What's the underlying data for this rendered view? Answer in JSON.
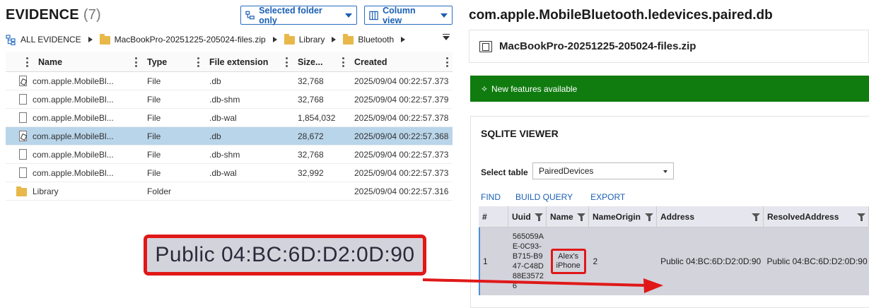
{
  "evidence": {
    "title": "EVIDENCE",
    "count": "(7)",
    "buttons": {
      "folder_filter": "Selected folder only",
      "column_view": "Column view"
    },
    "breadcrumb": [
      "ALL EVIDENCE",
      "MacBookPro-20251225-205024-files.zip",
      "Library",
      "Bluetooth"
    ],
    "columns": [
      "Name",
      "Type",
      "File extension",
      "Size...",
      "Created"
    ],
    "rows": [
      {
        "name": "com.apple.MobileBl...",
        "type": "File",
        "ext": ".db",
        "size": "32,768",
        "created": "2025/09/04 00:22:57.373",
        "icon": "sqlite-file-icon"
      },
      {
        "name": "com.apple.MobileBl...",
        "type": "File",
        "ext": ".db-shm",
        "size": "32,768",
        "created": "2025/09/04 00:22:57.379",
        "icon": "file-icon"
      },
      {
        "name": "com.apple.MobileBl...",
        "type": "File",
        "ext": ".db-wal",
        "size": "1,854,032",
        "created": "2025/09/04 00:22:57.378",
        "icon": "file-icon"
      },
      {
        "name": "com.apple.MobileBl...",
        "type": "File",
        "ext": ".db",
        "size": "28,672",
        "created": "2025/09/04 00:22:57.368",
        "icon": "sqlite-file-icon",
        "selected": true
      },
      {
        "name": "com.apple.MobileBl...",
        "type": "File",
        "ext": ".db-shm",
        "size": "32,768",
        "created": "2025/09/04 00:22:57.373",
        "icon": "file-icon"
      },
      {
        "name": "com.apple.MobileBl...",
        "type": "File",
        "ext": ".db-wal",
        "size": "32,992",
        "created": "2025/09/04 00:22:57.373",
        "icon": "file-icon"
      },
      {
        "name": "Library",
        "type": "Folder",
        "ext": "",
        "size": "",
        "created": "2025/09/04 00:22:57.316",
        "icon": "folder-icon"
      }
    ]
  },
  "callout": {
    "text": "Public 04:BC:6D:D2:0D:90",
    "border_color": "#e01818"
  },
  "detail": {
    "title": "com.apple.MobileBluetooth.ledevices.paired.db",
    "container": "MacBookPro-20251225-205024-files.zip",
    "banner": "New features available",
    "banner_color": "#107c10"
  },
  "sqlite": {
    "title": "SQLITE VIEWER",
    "select_label": "Select table",
    "selected_table": "PairedDevices",
    "actions": [
      "FIND",
      "BUILD QUERY",
      "EXPORT"
    ],
    "columns": [
      "#",
      "Uuid",
      "Name",
      "NameOrigin",
      "Address",
      "ResolvedAddress"
    ],
    "row": {
      "num": "1",
      "uuid": "565059AE-0C93-B715-B947-C48D88E35726",
      "name": "Alex's iPhone",
      "name_origin": "2",
      "address": "Public 04:BC:6D:D2:0D:90",
      "resolved_address": "Public 04:BC:6D:D2:0D:90"
    }
  },
  "colors": {
    "accent": "#1a5fb4",
    "selection": "#b9d5ea",
    "highlight": "#e01818"
  }
}
